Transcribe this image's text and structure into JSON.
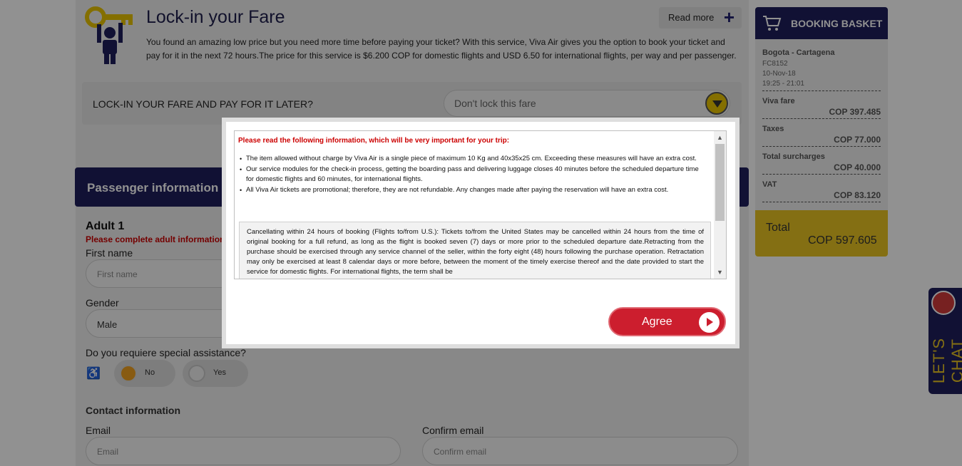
{
  "fare": {
    "title": "Lock-in your Fare",
    "read_more": "Read more",
    "description": "You found an amazing low price but you need more time before paying your ticket? With this service, Viva Air gives you the option to book your ticket and pay for it in the next 72 hours.The price for this service is $6.200 COP for domestic flights and USD 6.50 for international flights, per way and per passenger.",
    "lock_question": "LOCK-IN YOUR FARE AND PAY FOR IT LATER?",
    "lock_selected": "Don't lock this fare"
  },
  "passenger": {
    "header": "Passenger information",
    "adult_title": "Adult 1",
    "adult_warning": "Please complete adult information",
    "first_name_label": "First name",
    "first_name_placeholder": "First name",
    "gender_label": "Gender",
    "gender_value": "Male",
    "assistance_question": "Do you requiere special assistance?",
    "assistance_no": "No",
    "assistance_yes": "Yes",
    "contact_title": "Contact information",
    "email_label": "Email",
    "email_placeholder": "Email",
    "confirm_email_label": "Confirm email",
    "confirm_email_placeholder": "Confirm email"
  },
  "basket": {
    "title": "BOOKING BASKET",
    "route": "Bogota - Cartagena",
    "flight": "FC8152",
    "date": "10-Nov-18",
    "time": "19:25 - 21:01",
    "lines": [
      {
        "label": "Viva fare",
        "value": "COP 397.485"
      },
      {
        "label": "Taxes",
        "value": "COP 77.000"
      },
      {
        "label": "Total surcharges",
        "value": "COP 40.000"
      },
      {
        "label": "VAT",
        "value": "COP 83.120"
      }
    ],
    "total_label": "Total",
    "total_value": "COP 597.605"
  },
  "chat": {
    "label": "LET'S CHAT"
  },
  "modal": {
    "heading": "Please read the following information, which will be very important for your trip:",
    "bullets": [
      "The item allowed without charge by Viva Air is a single piece of maximum 10 Kg and 40x35x25 cm. Exceeding these measures will have an extra cost.",
      "Our service modules for the check-in process, getting the boarding pass and delivering luggage closes 40 minutes before the scheduled departure time for domestic flights and 60 minutes, for international flights.",
      "All Viva Air tickets are promotional; therefore, they are not refundable. Any changes made after paying the reservation will have an extra cost."
    ],
    "policy": "Cancellating within 24 hours of booking (Flights to/from U.S.): Tickets to/from the United States may be cancelled within 24 hours from the time of original booking for a full refund, as long as the flight is booked seven (7) days or more prior to the scheduled departure date.Retracting from the purchase should be exercised through any service channel of the seller, within the forty eight (48) hours following the purchase operation.  Retractation may only be exercised at least 8 calendar days or more before, between the moment of the timely exercise thereof and the date provided to start the service for domestic flights.  For international flights, the term shall be",
    "agree": "Agree"
  }
}
